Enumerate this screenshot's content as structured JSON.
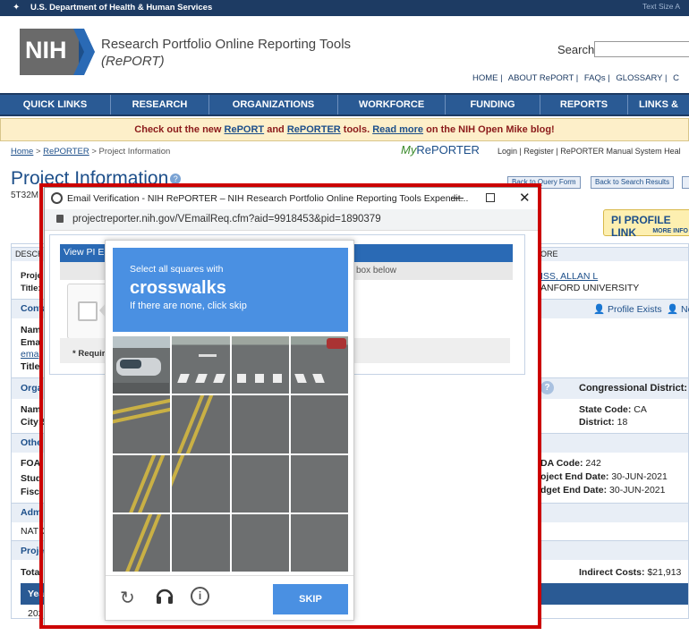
{
  "gov": {
    "title": "U.S. Department of Health & Human Services",
    "text_size": "Text Size  A"
  },
  "header": {
    "logo_text": "NIH",
    "title": "Research Portfolio Online Reporting Tools",
    "subtitle": "(RePORT)",
    "search_label": "Search"
  },
  "topnav": [
    "HOME |",
    "ABOUT RePORT |",
    "FAQs |",
    "GLOSSARY |",
    "C"
  ],
  "mainnav": [
    "QUICK LINKS",
    "RESEARCH",
    "ORGANIZATIONS",
    "WORKFORCE",
    "FUNDING",
    "REPORTS",
    "LINKS &"
  ],
  "announce": {
    "pre": "Check out the new ",
    "l1": "RePORT",
    "mid": " and ",
    "l2": "RePORTER",
    "mid2": " tools. ",
    "l3": "Read more",
    "post": " on the NIH Open Mike blog!"
  },
  "crumbs": {
    "home": "Home",
    "sep1": " > ",
    "reporter": "RePORTER",
    "sep2": " > Project Information"
  },
  "myreporter": {
    "my": "My",
    "rep": "RePORTER"
  },
  "userlinks": "Login |  Register |  RePORTER Manual    System Heal",
  "page": {
    "title": "Project Information",
    "number": "5T32M"
  },
  "buttons": {
    "back_query": "Back to Query Form",
    "back_search": "Back to Search Results"
  },
  "pilinks": {
    "label": "PI PROFILE LINK",
    "more": "MORE INFO"
  },
  "bg": {
    "descr": "DESCR",
    "proj": "Proje",
    "title": "Title:",
    "cont": "Conta",
    "nam": "Nam",
    "ema": "Ema",
    "ema2": "ema",
    "title2": "Title",
    "orga": "Orga",
    "nam2": "Nam",
    "city": "City:S",
    "othe": "Othe",
    "foa": "FOA:",
    "stud": "Stud",
    "fisc": "Fisc",
    "adm": "Adm",
    "natio": "NATIO",
    "proje": "Proje",
    "total": "Total",
    "year": "Yea",
    "yr": "202",
    "more": "ORE",
    "pi_name": "ISS, ALLAN L",
    "pi_org": "ANFORD UNIVERSITY",
    "profile": "Profile Exists",
    "no": "No",
    "cong": "Congressional District:",
    "state": "State Code:",
    "state_v": "CA",
    "district": "District:",
    "district_v": "18",
    "cfda": "DA Code:",
    "cfda_v": "242",
    "pend": "oject End Date:",
    "pend_v": "30-JUN-2021",
    "bend": "dget End Date:",
    "bend_v": "30-JUN-2021",
    "indirect": "Indirect Costs:",
    "indirect_v": "$21,913"
  },
  "popup": {
    "window_title": "Email Verification - NIH RePORTER – NIH Research Portfolio Online Reporting Tools Expendit...",
    "url": "projectreporter.nih.gov/VEmailReq.cfm?aid=9918453&pid=1890379",
    "view_pi": "View PI E",
    "box_below": "box below",
    "required": "* Require"
  },
  "captcha": {
    "instruction": "Select all squares with",
    "target": "crosswalks",
    "hint": "If there are none, click skip",
    "skip": "SKIP"
  }
}
